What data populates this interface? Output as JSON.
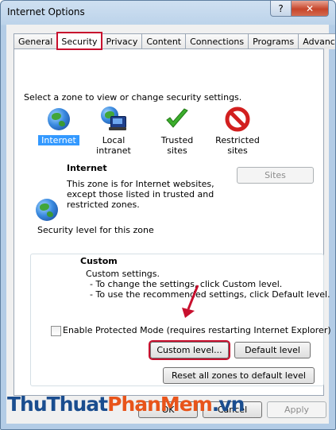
{
  "window": {
    "title": "Internet Options",
    "help_label": "?",
    "close_label": "✕"
  },
  "tabs": [
    {
      "label": "General"
    },
    {
      "label": "Security"
    },
    {
      "label": "Privacy"
    },
    {
      "label": "Content"
    },
    {
      "label": "Connections"
    },
    {
      "label": "Programs"
    },
    {
      "label": "Advanced"
    }
  ],
  "zones": {
    "prompt": "Select a zone to view or change security settings.",
    "items": [
      {
        "label_line1": "Internet",
        "label_line2": "",
        "icon": "globe-icon",
        "selected": true
      },
      {
        "label_line1": "Local intranet",
        "label_line2": "",
        "icon": "intranet-icon",
        "selected": false
      },
      {
        "label_line1": "Trusted sites",
        "label_line2": "",
        "icon": "checkmark-icon",
        "selected": false
      },
      {
        "label_line1": "Restricted",
        "label_line2": "sites",
        "icon": "restricted-icon",
        "selected": false
      }
    ]
  },
  "zone_info": {
    "name": "Internet",
    "desc1": "This zone is for Internet websites,",
    "desc2": "except those listed in trusted and",
    "desc3": "restricted zones.",
    "sites_button": "Sites"
  },
  "security_level": {
    "legend": "Security level for this zone",
    "level_name": "Custom",
    "line1": "Custom settings.",
    "line2": "- To change the settings, click Custom level.",
    "line3": "- To use the recommended settings, click Default level.",
    "protected_mode_label": "Enable Protected Mode (requires restarting Internet Explorer)",
    "protected_mode_checked": false,
    "custom_level_button": "Custom level...",
    "default_level_button": "Default level"
  },
  "reset_button": "Reset all zones to default level",
  "footer": {
    "ok_button": "OK",
    "cancel_button": "Cancel",
    "apply_button": "Apply"
  },
  "watermark": {
    "part1": "ThuThuat",
    "part2": "PhanMem",
    "part3": ".vn"
  },
  "colors": {
    "selection": "#3399ff",
    "highlight_box": "#c8102e",
    "arrow": "#c8102e"
  }
}
